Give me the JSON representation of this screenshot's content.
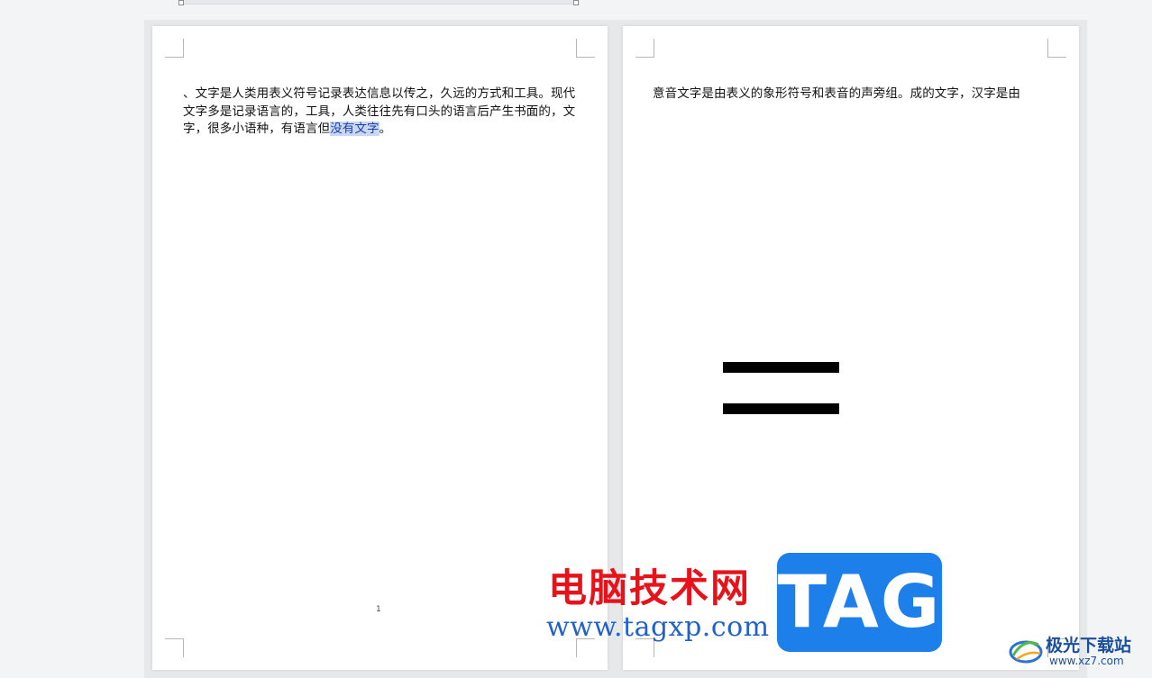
{
  "document": {
    "pages": [
      {
        "page_number": "1",
        "paragraph": {
          "before_selection": "、文字是人类用表义符号记录表达信息以传之，久远的方式和工具。现代文字多是记录语言的，工具，人类往往先有口头的语言后产生书面的，文字，很多小语种，有语言但",
          "selected_text": "没有文字",
          "after_selection": "。"
        }
      },
      {
        "paragraph": "意音文字是由表义的象形符号和表音的声旁组。成的文字，汉字是由",
        "shape": "equals-sign"
      }
    ]
  },
  "watermarks": {
    "site_name": "电脑技术网",
    "site_url": "www.tagxp.com",
    "tag_logo": "TAG",
    "corner_name": "极光下载站",
    "corner_url": "www.xz7.com"
  },
  "colors": {
    "selection_bg": "#c9d7f2",
    "selection_text": "#1a3fa8",
    "site_name_red": "#e8121b",
    "site_url_blue": "#1f62c9",
    "tag_blue": "#1d80ea"
  }
}
